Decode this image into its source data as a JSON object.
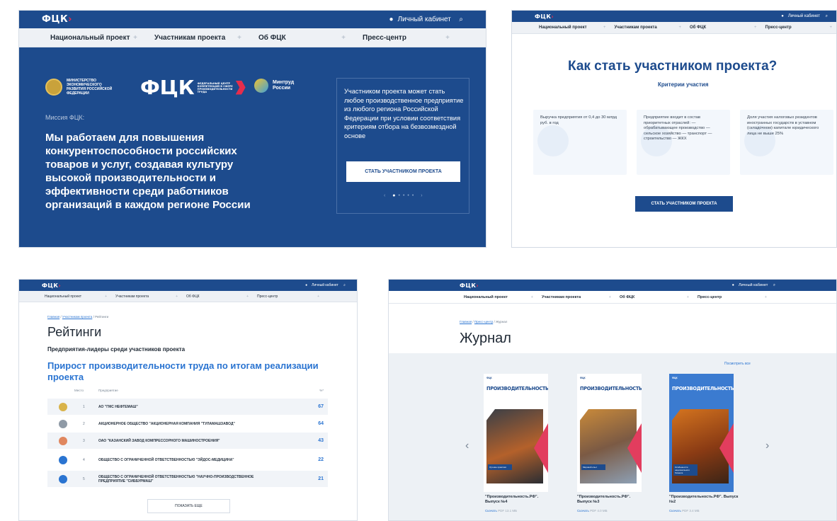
{
  "common": {
    "logo": "ФЦК",
    "cabinet": "Личный кабинет",
    "nav": [
      "Национальный проект",
      "Участникам проекта",
      "Об ФЦК",
      "Пресс-центр"
    ]
  },
  "hero": {
    "ministry": "МИНИСТЕРСТВО ЭКОНОМИЧЕСКОГО РАЗВИТИЯ РОССИЙСКОЙ ФЕДЕРАЦИИ",
    "big_logo": "ФЦК",
    "fck_sub": "ФЕДЕРАЛЬНЫЙ ЦЕНТР КОМПЕТЕНЦИЙ В СФЕРЕ ПРОИЗВОДИТЕЛЬНОСТИ ТРУДА",
    "mintrud": "Минтруд России",
    "mission_label": "Миссия ФЦК:",
    "mission": "Мы работаем для повышения конкурентоспособности российских товаров и услуг, создавая культуру высокой производительности и эффективности среди работников организаций в каждом регионе России",
    "card_text": "Участником проекта может стать любое производственное предприятие из любого региона Российской Федерации при условии соответствия критериям отбора на безвозмездной основе",
    "card_button": "СТАТЬ УЧАСТНИКОМ ПРОЕКТА"
  },
  "become": {
    "title": "Как стать участником проекта?",
    "subtitle": "Критерии участия",
    "criteria": [
      "Выручка предприятия от 0,4 до 30 млрд руб. в год",
      "Предприятие входит в состав приоритетных отраслей: — обрабатывающее производство — сельское хозяйство — транспорт — строительство — ЖКХ",
      "Доля участия налоговых резидентов иностранных государств в уставном (складочном) капитале юридического лица не выше 25%"
    ],
    "button": "СТАТЬ УЧАСТНИКОМ ПРОЕКТА"
  },
  "ratings": {
    "crumb_home": "Главная",
    "crumb_mid": "Участникам проекта",
    "crumb_cur": "Рейтинги",
    "title": "Рейтинги",
    "subtitle": "Предприятия-лидеры среди участников проекта",
    "heading": "Прирост производительности труда по итогам реализации проекта",
    "col_place": "Место",
    "col_company": "Предприятие",
    "col_pct": "%*",
    "rows": [
      {
        "place": "1",
        "name": "АО \"ГМС НЕФТЕМАШ\"",
        "score": "67",
        "medal": "#d9b34a"
      },
      {
        "place": "2",
        "name": "АКЦИОНЕРНОЕ ОБЩЕСТВО \"АКЦИОНЕРНАЯ КОМПАНИЯ \"ТУЛАМАШЗАВОД\"",
        "score": "64",
        "medal": "#8f9aa6"
      },
      {
        "place": "3",
        "name": "ОАО \"КАЗАНСКИЙ ЗАВОД КОМПРЕССОРНОГО МАШИНОСТРОЕНИЯ\"",
        "score": "43",
        "medal": "#e0875f"
      },
      {
        "place": "4",
        "name": "ОБЩЕСТВО С ОГРАНИЧЕННОЙ ОТВЕТСТВЕННОСТЬЮ \"ЭЙДОС-МЕДИЦИНА\"",
        "score": "22",
        "medal": "#2a74d1"
      },
      {
        "place": "5",
        "name": "ОБЩЕСТВО С ОГРАНИЧЕННОЙ ОТВЕТСТВЕННОСТЬЮ \"НАУЧНО-ПРОИЗВОДСТВЕННОЕ ПРЕДПРИЯТИЕ \"СИББУРМАШ\"",
        "score": "21",
        "medal": "#2a74d1"
      }
    ],
    "more": "ПОКАЗАТЬ ЕЩЕ"
  },
  "journal": {
    "crumb_home": "Главная",
    "crumb_mid": "Пресс-центр",
    "crumb_cur": "Журнал",
    "title": "Журнал",
    "view_all": "Посмотреть все",
    "mag_title": "ПРОИЗВОДИТЕЛЬНОСТЬ.РФ",
    "mag_head": "ФЦК",
    "issues": [
      {
        "caption": "\"Производительность.РФ\". Выпуск №4",
        "download": "Скачать",
        "meta": "PDF 13.1 МБ",
        "label": "Лучшие практики"
      },
      {
        "caption": "\"Производительность.РФ\". Выпуск №3",
        "download": "Скачать",
        "meta": "PDF 4.0 МБ",
        "label": "Мировой опыт"
      },
      {
        "caption": "\"Производительность.РФ\". Выпуск №2",
        "download": "Скачать",
        "meta": "PDF 3.4 МБ",
        "label": "Особенности национального бизнеса"
      }
    ]
  }
}
